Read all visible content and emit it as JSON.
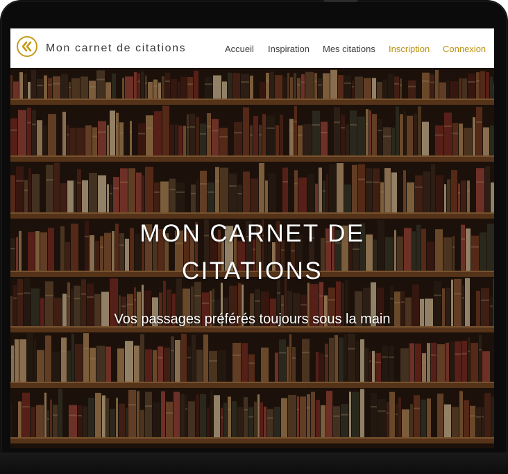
{
  "navbar": {
    "brand": "Mon carnet de citations",
    "logo_icon": "double-chevron-left-icon",
    "accent_color": "#c49a18",
    "links": [
      {
        "label": "Accueil"
      },
      {
        "label": "Inspiration"
      },
      {
        "label": "Mes citations"
      },
      {
        "label": "Inscription"
      },
      {
        "label": "Connexion"
      }
    ]
  },
  "hero": {
    "title_line1": "MON CARNET DE",
    "title_line2": "CITATIONS",
    "subtitle": "Vos passages préférés toujours sous la main",
    "background": "bookshelf-image"
  }
}
